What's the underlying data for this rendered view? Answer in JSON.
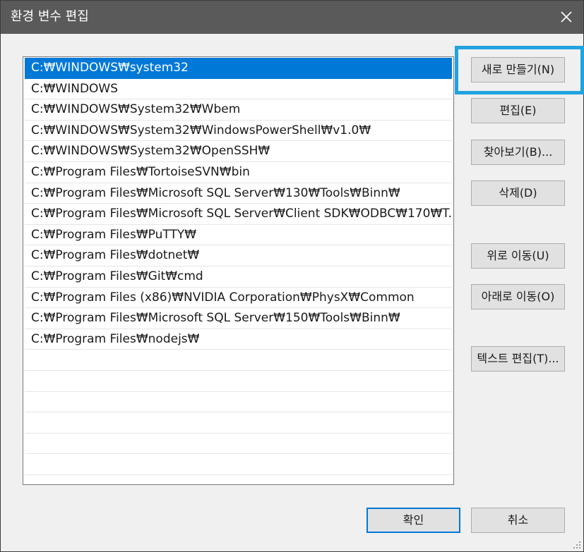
{
  "window": {
    "title": "환경 변수 편집"
  },
  "paths": [
    "C:₩WINDOWS₩system32",
    "C:₩WINDOWS",
    "C:₩WINDOWS₩System32₩Wbem",
    "C:₩WINDOWS₩System32₩WindowsPowerShell₩v1.0₩",
    "C:₩WINDOWS₩System32₩OpenSSH₩",
    "C:₩Program Files₩TortoiseSVN₩bin",
    "C:₩Program Files₩Microsoft SQL Server₩130₩Tools₩Binn₩",
    "C:₩Program Files₩Microsoft SQL Server₩Client SDK₩ODBC₩170₩T...",
    "C:₩Program Files₩PuTTY₩",
    "C:₩Program Files₩dotnet₩",
    "C:₩Program Files₩Git₩cmd",
    "C:₩Program Files (x86)₩NVIDIA Corporation₩PhysX₩Common",
    "C:₩Program Files₩Microsoft SQL Server₩150₩Tools₩Binn₩",
    "C:₩Program Files₩nodejs₩"
  ],
  "selected_index": 0,
  "buttons": {
    "new": "새로 만들기(N)",
    "edit": "편집(E)",
    "browse": "찾아보기(B)...",
    "delete": "삭제(D)",
    "move_up": "위로 이동(U)",
    "move_down": "아래로 이동(O)",
    "edit_text": "텍스트 편집(T)...",
    "ok": "확인",
    "cancel": "취소"
  },
  "colors": {
    "selection": "#0078d7",
    "highlight_box": "#21a3e0",
    "titlebar": "#5a5a5a"
  },
  "icons": {
    "close": "close-icon",
    "resize": "resize-grip-icon"
  }
}
